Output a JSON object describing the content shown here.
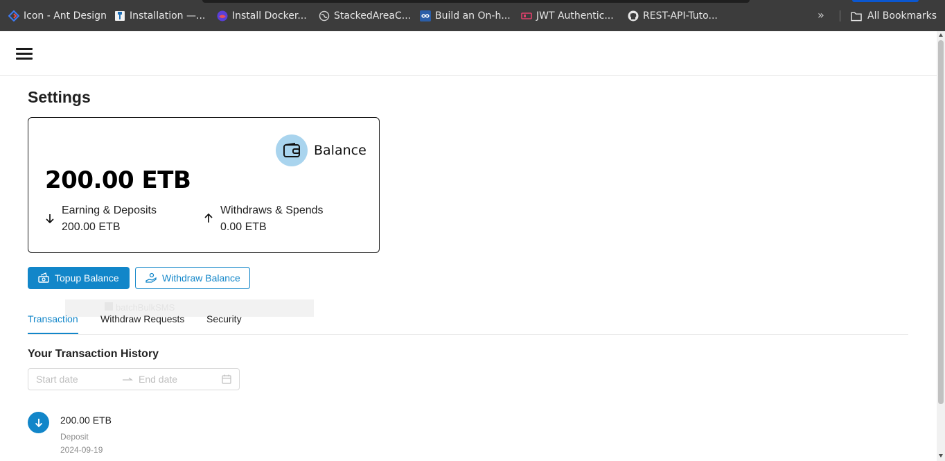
{
  "bookmarks": {
    "items": [
      {
        "label": "Icon - Ant Design",
        "icon": "ant-design-icon"
      },
      {
        "label": "Installation —...",
        "icon": "doc-icon"
      },
      {
        "label": "Install Docker...",
        "icon": "docker-icon"
      },
      {
        "label": "StackedAreaC...",
        "icon": "globe-icon"
      },
      {
        "label": "Build an On-h...",
        "icon": "infinity-icon"
      },
      {
        "label": "JWT Authentic...",
        "icon": "jwt-icon"
      },
      {
        "label": "REST-API-Tuto...",
        "icon": "github-icon"
      }
    ],
    "more": "»",
    "all_bookmarks": "All Bookmarks"
  },
  "page": {
    "title": "Settings"
  },
  "balance_card": {
    "badge_label": "Balance",
    "amount": "200.00 ETB",
    "earning_label": "Earning & Deposits",
    "earning_value": "200.00 ETB",
    "withdraw_label": "Withdraws & Spends",
    "withdraw_value": "0.00 ETB"
  },
  "actions": {
    "topup": "Topup Balance",
    "withdraw": "Withdraw Balance"
  },
  "ghost_text": "batchBulkSMS",
  "tabs": [
    {
      "label": "Transaction",
      "active": true
    },
    {
      "label": "Withdraw Requests",
      "active": false
    },
    {
      "label": "Security",
      "active": false
    }
  ],
  "transactions": {
    "title": "Your Transaction History",
    "start_placeholder": "Start date",
    "end_placeholder": "End date",
    "items": [
      {
        "amount": "200.00 ETB",
        "type": "Deposit",
        "date": "2024-09-19"
      }
    ]
  },
  "colors": {
    "accent": "#1286c9",
    "wallet_bg": "#a9d4ee",
    "bookmark_bar": "#3c3c3c"
  }
}
